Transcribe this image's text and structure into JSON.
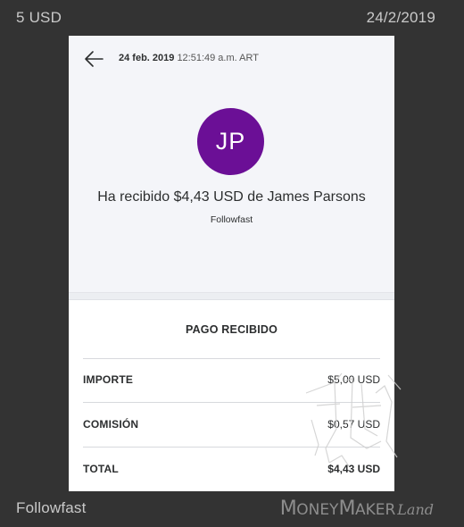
{
  "frame": {
    "top_left": "5 USD",
    "top_right": "24/2/2019",
    "bottom_left": "Followfast",
    "brand_part1": "M",
    "brand_part2": "ONEY",
    "brand_part3": "M",
    "brand_part4": "AKER",
    "brand_part5": "Land"
  },
  "header": {
    "back_icon": "arrow-left-icon",
    "date_bold": "24 feb. 2019",
    "time": "12:51:49 a.m. ART"
  },
  "profile": {
    "initials": "JP",
    "avatar_color": "#6b0f96",
    "headline": "Ha recibido $4,43 USD de James Parsons",
    "subtitle": "Followfast"
  },
  "details": {
    "title": "PAGO RECIBIDO",
    "rows": [
      {
        "label": "IMPORTE",
        "value": "$5,00 USD"
      },
      {
        "label": "COMISIÓN",
        "value": "$0,57 USD"
      },
      {
        "label": "TOTAL",
        "value": "$4,43 USD"
      }
    ]
  },
  "colors": {
    "background": "#333333",
    "panel_top": "#f4f5f9",
    "text": "#2c2e2f"
  }
}
